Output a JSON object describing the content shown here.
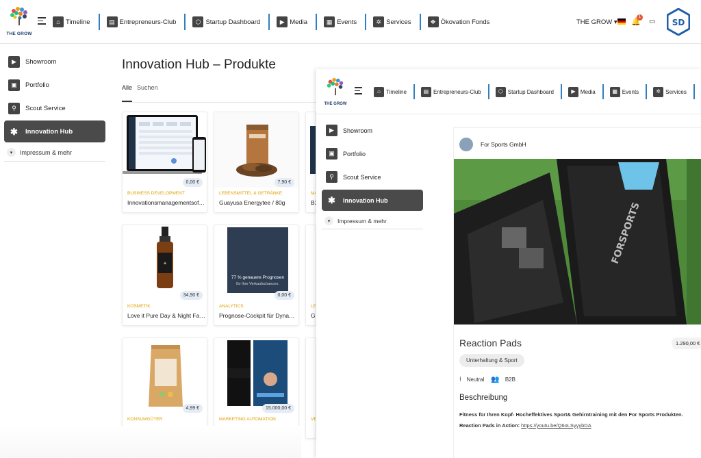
{
  "app": {
    "logo_text": "THE GROW",
    "brand_mark": "SD"
  },
  "topnav": {
    "items": [
      {
        "label": "Timeline",
        "icon": "home-icon"
      },
      {
        "label": "Entrepreneurs-Club",
        "icon": "id-card-icon"
      },
      {
        "label": "Startup Dashboard",
        "icon": "cube-icon"
      },
      {
        "label": "Media",
        "icon": "play-icon"
      },
      {
        "label": "Events",
        "icon": "calendar-icon"
      },
      {
        "label": "Services",
        "icon": "gear-icon"
      },
      {
        "label": "Ökovation Fonds",
        "icon": "leaf-icon"
      }
    ],
    "user_menu": "THE GROW ▾",
    "notification_count": "1"
  },
  "sidebar": {
    "items": [
      {
        "label": "Showroom",
        "icon": "play-icon",
        "active": false
      },
      {
        "label": "Portfolio",
        "icon": "portfolio-icon",
        "active": false
      },
      {
        "label": "Scout Service",
        "icon": "scout-icon",
        "active": false
      },
      {
        "label": "Innovation Hub",
        "icon": "asterisk-icon",
        "active": true
      }
    ],
    "submenu_label": "Impressum & mehr"
  },
  "main": {
    "title": "Innovation Hub – Produkte",
    "tabs": [
      "Alle",
      "Suchen"
    ],
    "products": [
      {
        "category": "BUSINESS DEVELOPMENT",
        "title": "Innovationsmanagementsof…",
        "price": "0,00 €"
      },
      {
        "category": "LEBENSMITTEL & GETRÄNKE",
        "title": "Guayusa Energytee / 80g",
        "price": "7,90 €"
      },
      {
        "category": "KOSMETIK",
        "title": "Love it Pure Day & Night Fa…",
        "price": "34,90 €"
      },
      {
        "category": "ANALYTICS",
        "title": "Prognose-Cockpit für Dyna…",
        "price": "0,00 €",
        "image_text": "77 % genauere Prognosen",
        "image_subtext": "für Ihre Verkaufschancen."
      },
      {
        "category": "KONSUMGÜTER",
        "title": "",
        "price": "4,99 €"
      },
      {
        "category": "MARKETING AUTOMATION",
        "title": "",
        "price": "15.000,00 €"
      }
    ],
    "partial_cards": [
      {
        "category": "MA",
        "title": "B2"
      },
      {
        "category": "LE",
        "title": "Gu"
      },
      {
        "category": "VE",
        "title": ""
      }
    ]
  },
  "overlay": {
    "logo_text": "THE GROW",
    "topnav": [
      "Timeline",
      "Entrepreneurs-Club",
      "Startup Dashboard",
      "Media",
      "Events",
      "Services"
    ],
    "sidebar": [
      "Showroom",
      "Portfolio",
      "Scout Service",
      "Innovation Hub"
    ],
    "submenu_label": "Impressum & mehr",
    "detail": {
      "seller": "For Sports GmbH",
      "image_brand_text": "FORSPORTS",
      "title": "Reaction Pads",
      "price": "1.290,00 €",
      "category_tag": "Unterhaltung & Sport",
      "sentiment": "Neutral",
      "audience": "B2B",
      "description_heading": "Beschreibung",
      "description_line1": "Fitness für Ihren Kopf- Hocheffektives Sport& Gehirntraining mit den For Sports Produkten.",
      "description_line2_label": "Reaction Pads in Action: ",
      "description_line2_link": "https://youtu.be/Q6oLSyyybDA"
    }
  },
  "colors": {
    "accent_blue": "#2f7fc1",
    "category_orange": "#e0a000",
    "active_bg": "#4a4a4a",
    "price_badge": "#e4ecf5"
  }
}
